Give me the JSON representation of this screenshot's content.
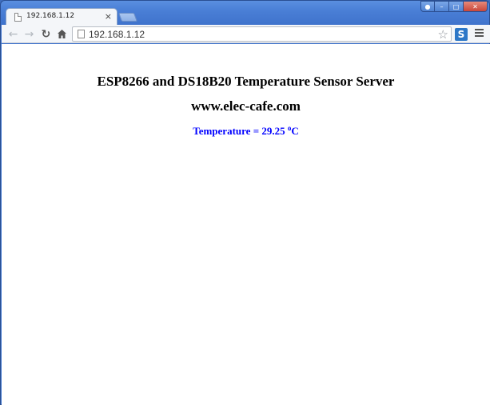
{
  "browser": {
    "tab": {
      "title": "192.168.1.12",
      "close_glyph": "×"
    },
    "address_bar": {
      "url": "192.168.1.12"
    },
    "icons": [
      "page-icon",
      "back-arrow-icon",
      "forward-arrow-icon",
      "reload-icon",
      "home-icon",
      "bookmark-star-icon",
      "extension-icon",
      "menu-icon"
    ],
    "window_controls": [
      "user",
      "minimize",
      "maximize",
      "close"
    ]
  },
  "page": {
    "heading": "ESP8266 and DS18B20 Temperature Sensor Server",
    "site": "www.elec-cafe.com",
    "temperature": {
      "label": "Temperature = 29.25 ",
      "degree": "o",
      "unit": "C"
    }
  },
  "colors": {
    "temperature_text": "#0000ff",
    "frame": "#4a7fd6"
  }
}
